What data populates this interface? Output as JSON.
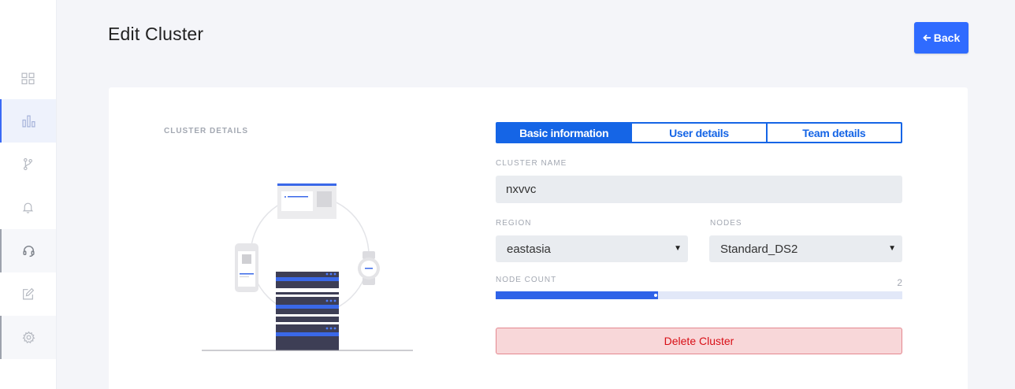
{
  "header": {
    "title": "Edit Cluster",
    "back_label": "Back"
  },
  "sidebar": {
    "items": [
      {
        "icon": "dashboard-grid-icon",
        "active": false
      },
      {
        "icon": "bar-chart-icon",
        "active": true
      },
      {
        "icon": "git-branch-icon",
        "active": false
      },
      {
        "icon": "bell-icon",
        "active": false
      },
      {
        "icon": "headset-icon",
        "active": false
      },
      {
        "icon": "edit-icon",
        "active": false
      },
      {
        "icon": "settings-icon",
        "active": false
      }
    ]
  },
  "card": {
    "section_label": "CLUSTER DETAILS",
    "tabs": [
      {
        "label": "Basic information",
        "active": true
      },
      {
        "label": "User details",
        "active": false
      },
      {
        "label": "Team details",
        "active": false
      }
    ],
    "fields": {
      "cluster_name_label": "CLUSTER NAME",
      "cluster_name_value": "nxvvc",
      "region_label": "REGION",
      "region_value": "eastasia",
      "nodes_label": "NODES",
      "nodes_value": "Standard_DS2",
      "node_count_label": "NODE COUNT",
      "node_count_value": "2",
      "node_count_fill_fraction": 0.4
    },
    "delete_label": "Delete Cluster"
  },
  "colors": {
    "primary": "#2f6bff",
    "tab_blue": "#1565e6",
    "danger_text": "#d80f16",
    "danger_bg": "#f8d7d9"
  }
}
